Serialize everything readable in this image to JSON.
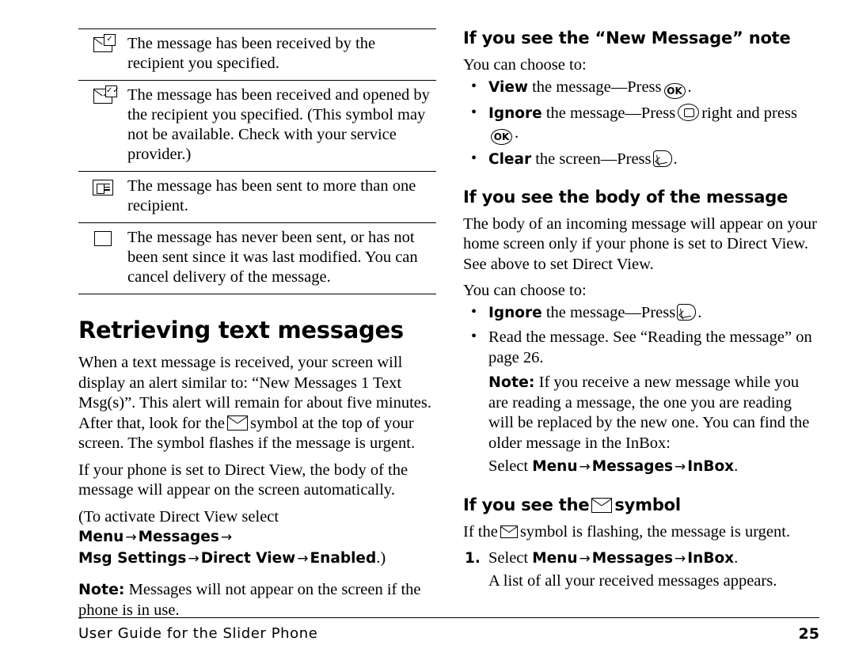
{
  "table": {
    "rows": [
      {
        "icon": "envelope-checked-icon",
        "text": "The message has been received by the recipient you specified."
      },
      {
        "icon": "envelope-double-checked-icon",
        "text": "The message has been received and opened by the recipient you specified. (This symbol may not be available. Check with your service provider.)"
      },
      {
        "icon": "multiple-recipients-icon",
        "text": "The message has been sent to more than one recipient."
      },
      {
        "icon": "empty-square-icon",
        "text": "The message has never been sent, or has not been sent since it was last modified. You can cancel delivery of the message."
      }
    ]
  },
  "left": {
    "section_title": "Retrieving text messages",
    "para1_a": "When a text message is received, your screen will display an alert similar to: “New Messages 1 Text Msg(s)”. This alert will remain for about five minutes. After that, look for the",
    "para1_b": "symbol at the top of your screen. The symbol flashes if the message is urgent.",
    "para2": "If your phone is set to Direct View, the body of the message will appear on the screen automatically.",
    "para3_a": "(To activate Direct View select",
    "menu": "Menu",
    "messages": "Messages",
    "msg_settings": "Msg Settings",
    "direct_view": "Direct View",
    "enabled": "Enabled",
    "para3_close": ".)",
    "note_label": "Note:",
    "note_text": "Messages will not appear on the screen if the phone is in use."
  },
  "right": {
    "heading1": "If you see the “New Message” note",
    "choose": "You can choose to:",
    "bullet1_a": "View",
    "bullet1_b": "the message—Press",
    "bullet1_c": ".",
    "bullet2_a": "Ignore",
    "bullet2_b": "the message—Press",
    "bullet2_c": "right and press",
    "bullet2_d": ".",
    "bullet3_a": "Clear",
    "bullet3_b": "the screen—Press",
    "bullet3_c": ".",
    "heading2": "If you see the body of the message",
    "para1": "The body of an incoming message will appear on your home screen only if your phone is set to Direct View. See above to set Direct View.",
    "choose2": "You can choose to:",
    "b2_1_a": "Ignore",
    "b2_1_b": "the message—Press",
    "b2_1_c": ".",
    "b2_2": "Read the message. See “Reading the message” on page 26.",
    "note_label": "Note:",
    "note_text": "If you receive a new message while you are reading a message, the one you are reading will be replaced by the new one. You can find the older message in the InBox:",
    "select": "Select",
    "menu": "Menu",
    "messages": "Messages",
    "inbox": "InBox",
    "period": ".",
    "heading3_a": "If you see the",
    "heading3_b": "symbol",
    "para_flash_a": "If the",
    "para_flash_b": "symbol is flashing, the message is urgent.",
    "step1_num": "1.",
    "step1_text": "Select",
    "step1_after": "A list of all your received messages appears."
  },
  "footer": {
    "text": "User Guide for the Slider Phone",
    "page": "25"
  }
}
